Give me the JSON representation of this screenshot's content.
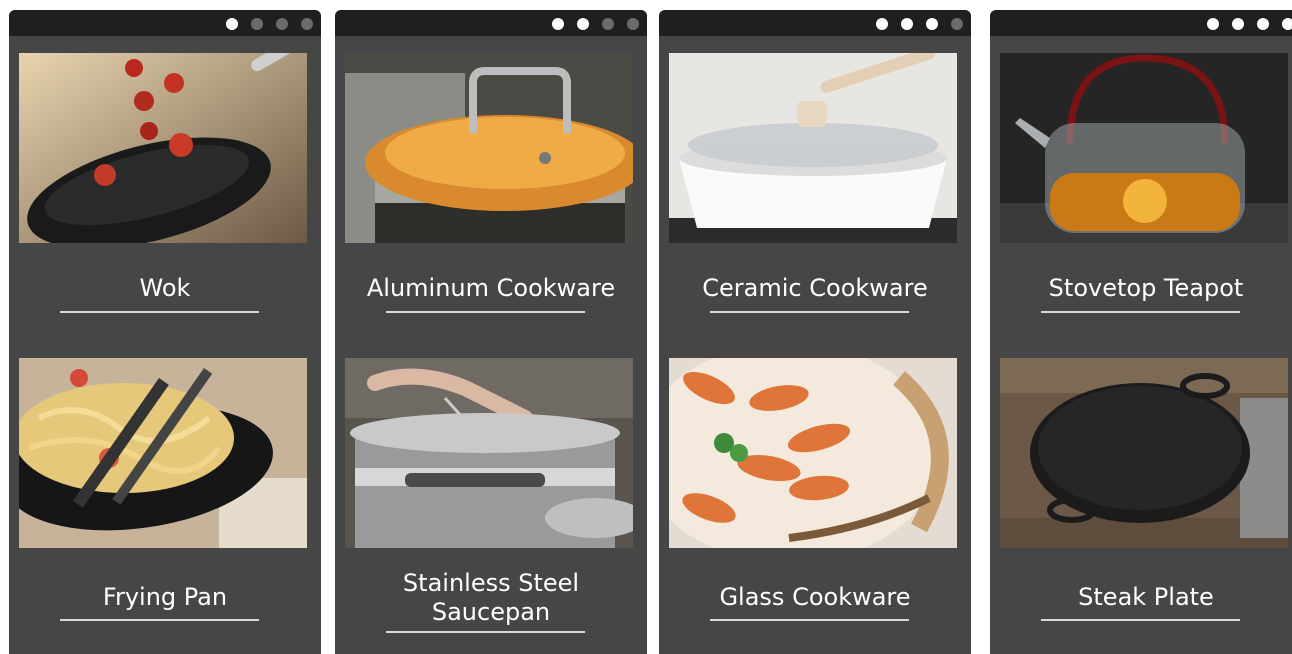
{
  "panels": [
    {
      "id": "panel-1",
      "dots": [
        true,
        false,
        false,
        false
      ],
      "top": {
        "label": "Wok",
        "image": "wok-photo"
      },
      "bottom": {
        "label": "Frying Pan",
        "image": "frying-pan-photo"
      }
    },
    {
      "id": "panel-2",
      "dots": [
        true,
        true,
        false,
        false
      ],
      "top": {
        "label": "Aluminum Cookware",
        "image": "aluminum-cookware-photo"
      },
      "bottom": {
        "label": "Stainless Steel\nSaucepan",
        "image": "stainless-steel-saucepan-photo"
      }
    },
    {
      "id": "panel-3",
      "dots": [
        true,
        true,
        true,
        false
      ],
      "top": {
        "label": "Ceramic Cookware",
        "image": "ceramic-cookware-photo"
      },
      "bottom": {
        "label": "Glass Cookware",
        "image": "glass-cookware-photo"
      }
    },
    {
      "id": "panel-4",
      "dots": [
        true,
        true,
        true,
        true
      ],
      "top": {
        "label": "Stovetop Teapot",
        "image": "stovetop-teapot-photo"
      },
      "bottom": {
        "label": "Steak Plate",
        "image": "steak-plate-photo"
      }
    }
  ],
  "colors": {
    "panel_bg": "#464646",
    "bar_bg": "#1f1f1f",
    "dot_active": "#ffffff",
    "dot_inactive": "#6b6b6b",
    "text": "#ffffff"
  }
}
